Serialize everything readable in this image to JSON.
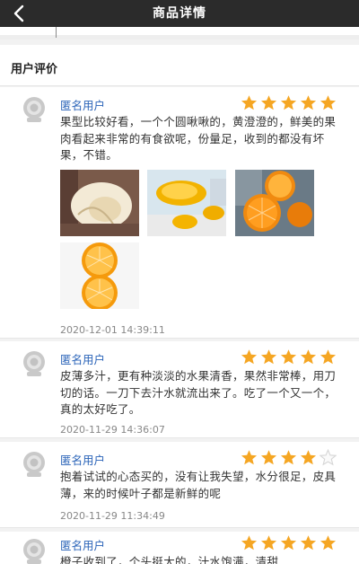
{
  "header": {
    "title": "商品详情"
  },
  "reviews_section": {
    "title": "用户评价"
  },
  "reviews": [
    {
      "user": "匿名用户",
      "rating": 5,
      "text": "果型比较好看，一个个圆啾啾的，黄澄澄的，鲜美的果肉看起来非常的有食欲呢，份量足，收到的都没有坏果，不错。",
      "date": "2020-12-01 14:39:11",
      "photo_count": 4
    },
    {
      "user": "匿名用户",
      "rating": 5,
      "text": "皮薄多汁，更有种淡淡的水果清香，果然非常棒，用刀切的话。一刀下去汁水就流出来了。吃了一个又一个，真的太好吃了。",
      "date": "2020-11-29 14:36:07"
    },
    {
      "user": "匿名用户",
      "rating": 4,
      "text": "抱着试试的心态买的，没有让我失望，水分很足，皮具薄，来的时候叶子都是新鲜的呢",
      "date": "2020-11-29 11:34:49"
    },
    {
      "user": "匿名用户",
      "rating": 5,
      "text": "橙子收到了，个头挺大的，汁水饱满，清甜"
    }
  ],
  "colors": {
    "header": "#2b2b2b",
    "star": "#f5a623",
    "star_empty": "#dcdcdc",
    "username": "#2a63b8"
  }
}
